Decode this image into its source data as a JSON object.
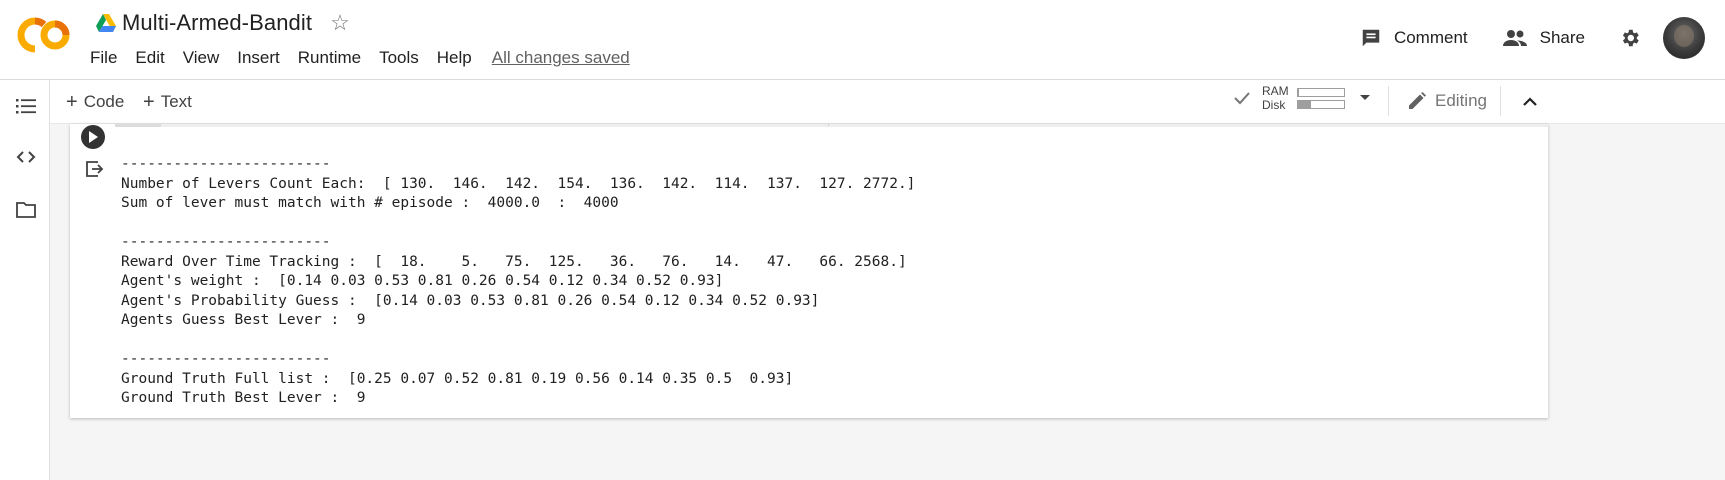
{
  "app": {
    "logo_text": "CO",
    "brand_color": "#F9AB00",
    "title": "Multi-Armed-Bandit"
  },
  "menu": {
    "items": [
      "File",
      "Edit",
      "View",
      "Insert",
      "Runtime",
      "Tools",
      "Help"
    ],
    "save_status": "All changes saved"
  },
  "header_actions": {
    "comment_label": "Comment",
    "share_label": "Share"
  },
  "toolbar": {
    "add_code_label": "Code",
    "add_text_label": "Text",
    "ram_label": "RAM",
    "disk_label": "Disk",
    "ram_fraction": 0.03,
    "disk_fraction": 0.3,
    "editing_label": "Editing"
  },
  "sidebar": {
    "icons": [
      "table-of-contents-icon",
      "code-snippets-icon",
      "files-icon"
    ]
  },
  "cell": {
    "output_lines": [
      "------------------------",
      "Number of Levers Count Each:  [ 130.  146.  142.  154.  136.  142.  114.  137.  127. 2772.]",
      "Sum of lever must match with # episode :  4000.0  :  4000",
      "",
      "------------------------",
      "Reward Over Time Tracking :  [  18.    5.   75.  125.   36.   76.   14.   47.   66. 2568.]",
      "Agent's weight :  [0.14 0.03 0.53 0.81 0.26 0.54 0.12 0.34 0.52 0.93]",
      "Agent's Probability Guess :  [0.14 0.03 0.53 0.81 0.26 0.54 0.12 0.34 0.52 0.93]",
      "Agents Guess Best Lever :  9",
      "",
      "------------------------",
      "Ground Truth Full list :  [0.25 0.07 0.52 0.81 0.19 0.56 0.14 0.35 0.5  0.93]",
      "Ground Truth Best Lever :  9"
    ]
  }
}
